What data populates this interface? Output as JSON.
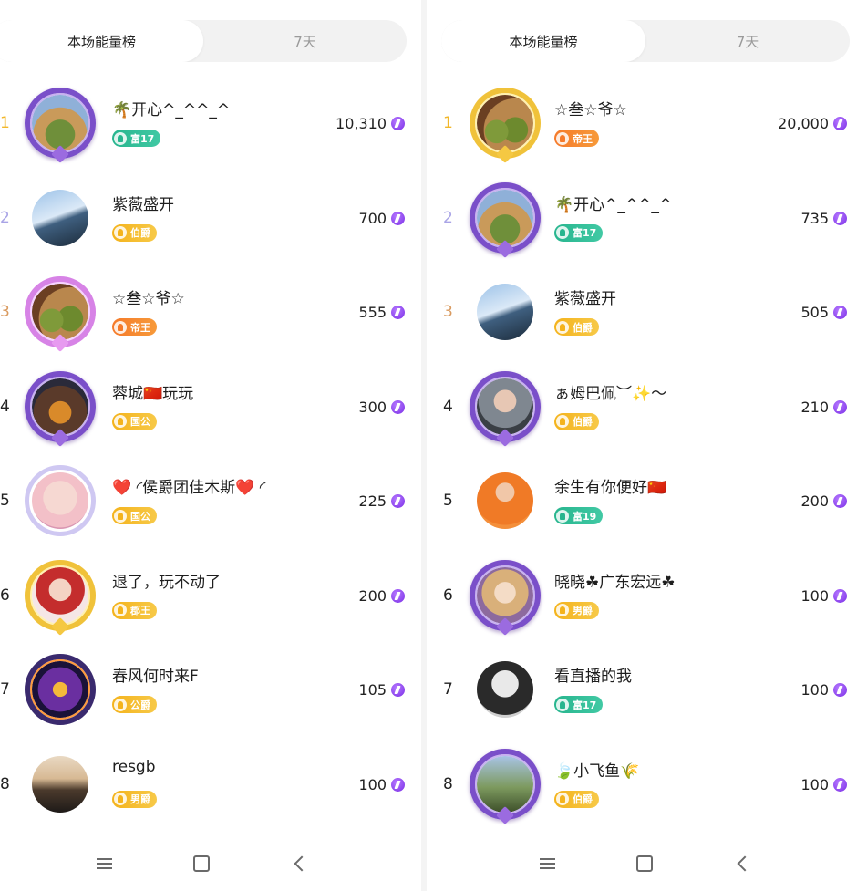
{
  "colors": {
    "rank1": "#f2b72a",
    "rank2": "#a9a4e6",
    "rank3": "#d99a5f",
    "energy": "#8a3cf0"
  },
  "left": {
    "tabs": [
      {
        "label": "本场能量榜",
        "active": true
      },
      {
        "label": "7天",
        "active": false
      }
    ],
    "rows": [
      {
        "rank": "1",
        "name": "🌴开心^_^^_^",
        "badge": "富17",
        "badge_color": "teal",
        "score": "10,310",
        "frame": "purple"
      },
      {
        "rank": "2",
        "name": "紫薇盛开",
        "badge": "伯爵",
        "badge_color": "gold",
        "score": "700",
        "frame": "none"
      },
      {
        "rank": "3",
        "name": "☆叁☆爷☆",
        "badge": "帝王",
        "badge_color": "orange",
        "score": "555",
        "frame": "pink"
      },
      {
        "rank": "4",
        "name": "蓉城🇨🇳玩玩",
        "badge": "国公",
        "badge_color": "gold",
        "score": "300",
        "frame": "purple"
      },
      {
        "rank": "5",
        "name": "❤️ ◜侯爵团佳木斯❤️ ◜",
        "badge": "国公",
        "badge_color": "gold",
        "score": "225",
        "frame": "lilac"
      },
      {
        "rank": "6",
        "name": "退了，玩不动了",
        "badge": "郡王",
        "badge_color": "gold",
        "score": "200",
        "frame": "gold"
      },
      {
        "rank": "7",
        "name": "春风何时来F",
        "badge": "公爵",
        "badge_color": "gold",
        "score": "105",
        "frame": "ember"
      },
      {
        "rank": "8",
        "name": "resgb",
        "badge": "男爵",
        "badge_color": "gold",
        "score": "100",
        "frame": "none"
      }
    ]
  },
  "right": {
    "tabs": [
      {
        "label": "本场能量榜",
        "active": true
      },
      {
        "label": "7天",
        "active": false
      }
    ],
    "rows": [
      {
        "rank": "1",
        "name": "☆叁☆爷☆",
        "badge": "帝王",
        "badge_color": "orange",
        "score": "20,000",
        "frame": "gold"
      },
      {
        "rank": "2",
        "name": "🌴开心^_^^_^",
        "badge": "富17",
        "badge_color": "teal",
        "score": "735",
        "frame": "purple"
      },
      {
        "rank": "3",
        "name": "紫薇盛开",
        "badge": "伯爵",
        "badge_color": "gold",
        "score": "505",
        "frame": "none"
      },
      {
        "rank": "4",
        "name": "ぁ姆巴佩︶✨～",
        "badge": "伯爵",
        "badge_color": "gold",
        "score": "210",
        "frame": "purple"
      },
      {
        "rank": "5",
        "name": "余生有你便好🇨🇳",
        "badge": "富19",
        "badge_color": "teal",
        "score": "200",
        "frame": "none"
      },
      {
        "rank": "6",
        "name": "晓晓☘广东宏远☘",
        "badge": "男爵",
        "badge_color": "gold",
        "score": "100",
        "frame": "purple"
      },
      {
        "rank": "7",
        "name": "看直播的我",
        "badge": "富17",
        "badge_color": "teal",
        "score": "100",
        "frame": "none"
      },
      {
        "rank": "8",
        "name": "🍃小飞鱼🌾",
        "badge": "伯爵",
        "badge_color": "gold",
        "score": "100",
        "frame": "purple"
      }
    ]
  },
  "icons": {
    "energy": "energy-bolt-icon",
    "menu": "menu-icon",
    "home": "home-icon",
    "back": "back-icon"
  }
}
